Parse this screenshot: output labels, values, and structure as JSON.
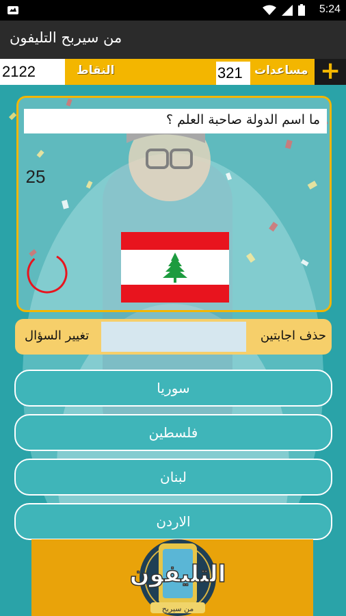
{
  "status_bar": {
    "time": "5:24",
    "icons": [
      "notification-icon",
      "wifi-icon",
      "signal-icon",
      "battery-icon"
    ]
  },
  "app_bar": {
    "title": "من سيربح التليفون"
  },
  "score_bar": {
    "points_value": "2122",
    "points_label": "النقاط",
    "helps_value": "321",
    "helps_label": "مساعدات",
    "add_icon": "plus-icon"
  },
  "question": {
    "text": "ما اسم الدولة صاحبة العلم ؟",
    "timer": "25",
    "timer_remaining_fraction": 0.8,
    "flag": "lebanon-flag"
  },
  "tools": {
    "delete_two": "حذف اجابتين",
    "change_question": "تغيير السؤال"
  },
  "answers": [
    "سوريا",
    "فلسطين",
    "لبنان",
    "الاردن"
  ],
  "logo": {
    "title": "التليفون",
    "subtitle": "من سيربح"
  },
  "colors": {
    "accent": "#f3b600",
    "background": "#2aa3a8",
    "appbar": "#2b2b2b",
    "flag_red": "#e8141e",
    "cedar_green": "#1d9b3f"
  }
}
